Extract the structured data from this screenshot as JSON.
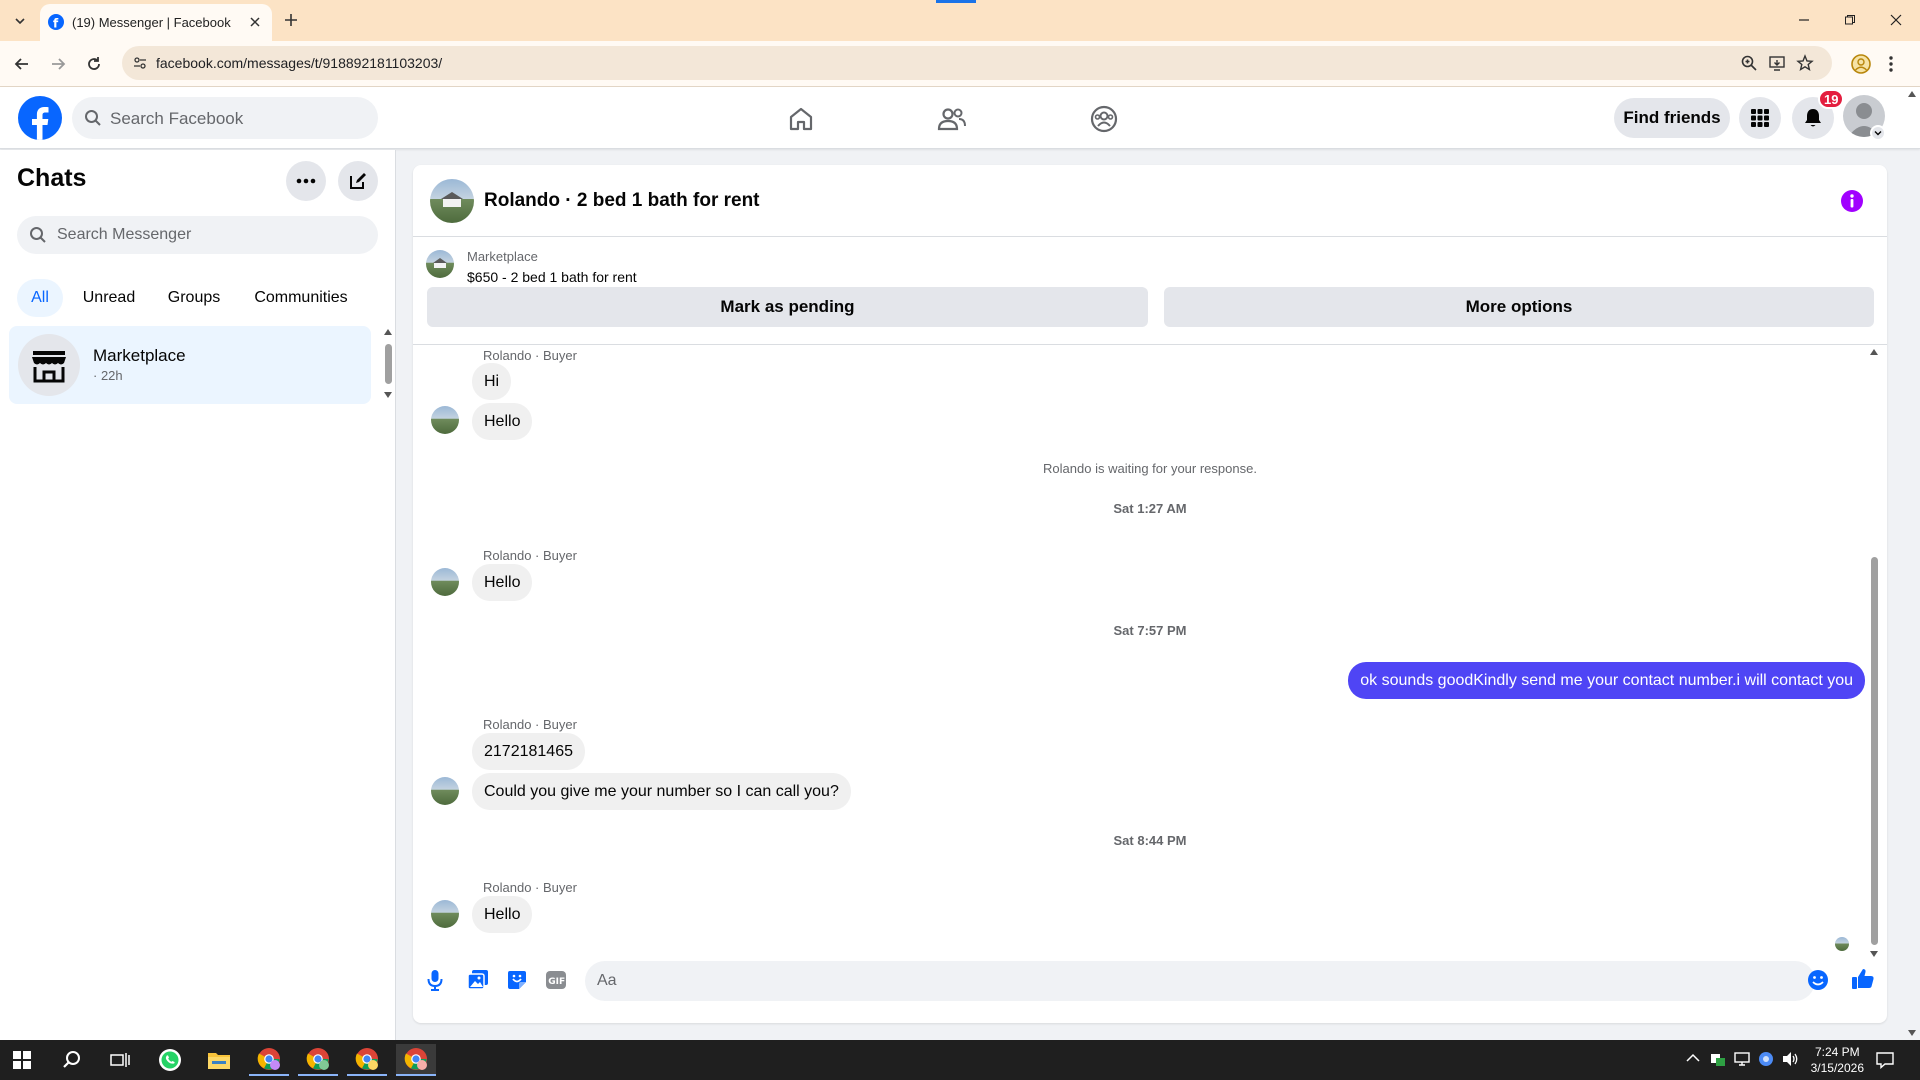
{
  "browser": {
    "tab_title": "(19) Messenger | Facebook",
    "url": "facebook.com/messages/t/918892181103203/"
  },
  "fb_nav": {
    "search_placeholder": "Search Facebook",
    "find_friends_label": "Find friends",
    "notification_count": "19"
  },
  "sidebar": {
    "title": "Chats",
    "search_placeholder": "Search Messenger",
    "filters": [
      "All",
      "Unread",
      "Groups",
      "Communities"
    ],
    "chats": [
      {
        "name": "Marketplace",
        "time": "· 22h"
      }
    ]
  },
  "conversation": {
    "title": "Rolando · 2 bed 1 bath for rent",
    "listing": {
      "source": "Marketplace",
      "title": "$650 - 2 bed 1 bath for rent"
    },
    "actions": [
      "Mark as pending",
      "More options"
    ],
    "messages": [
      {
        "sender": "Rolando · Buyer",
        "bubbles": [
          "Hi",
          "Hello"
        ]
      },
      {
        "note": "Rolando is waiting for your response."
      },
      {
        "timestamp": "Sat 1:27 AM"
      },
      {
        "sender": "Rolando · Buyer",
        "bubbles": [
          "Hello"
        ]
      },
      {
        "timestamp": "Sat 7:57 PM"
      },
      {
        "me": "ok sounds goodKindly send me your contact number.i will contact you"
      },
      {
        "sender": "Rolando · Buyer",
        "bubbles": [
          "2172181465",
          "Could you give me your number so I can call you?"
        ]
      },
      {
        "timestamp": "Sat 8:44 PM"
      },
      {
        "sender": "Rolando · Buyer",
        "bubbles": [
          "Hello"
        ]
      }
    ],
    "composer_placeholder": "Aa"
  },
  "taskbar": {
    "time": "7:24 PM",
    "date": "3/15/2026"
  },
  "colors": {
    "fb_blue": "#0866ff",
    "my_bubble": "#4f45f5",
    "notif_red": "#e41e3f"
  }
}
